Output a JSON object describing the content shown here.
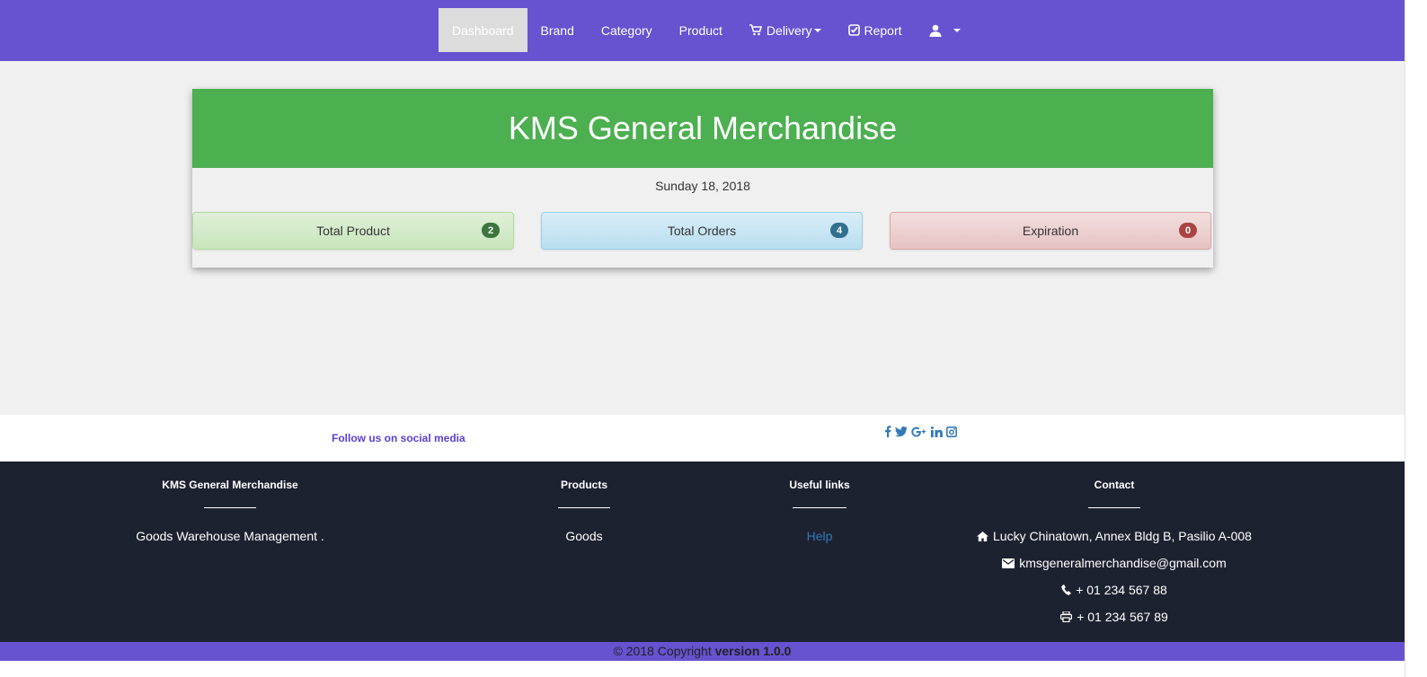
{
  "nav": {
    "items": [
      {
        "label": "Dashboard"
      },
      {
        "label": "Brand"
      },
      {
        "label": "Category"
      },
      {
        "label": "Product"
      },
      {
        "label": "Delivery",
        "icon": "cart-icon"
      },
      {
        "label": "Report",
        "icon": "check-square-icon"
      }
    ],
    "user_icon": "user-icon"
  },
  "header": {
    "title": "KMS General Merchandise",
    "date": "Sunday 18, 2018"
  },
  "stats": [
    {
      "label": "Total Product",
      "count": "2"
    },
    {
      "label": "Total Orders",
      "count": "4"
    },
    {
      "label": "Expiration",
      "count": "0"
    }
  ],
  "social": {
    "follow_text": "Follow us on social media",
    "icons": [
      "facebook-icon",
      "twitter-icon",
      "google-plus-icon",
      "linkedin-icon",
      "instagram-icon"
    ]
  },
  "footer": {
    "company": {
      "heading": "KMS General Merchandise",
      "text": "Goods Warehouse Management ."
    },
    "products": {
      "heading": "Products",
      "item": "Goods"
    },
    "links": {
      "heading": "Useful links",
      "item": "Help"
    },
    "contact": {
      "heading": "Contact",
      "address": "Lucky Chinatown, Annex Bldg B, Pasilio A-008",
      "email": "kmsgeneralmerchandise@gmail.com",
      "phone": "+ 01 234 567 88",
      "fax": "+ 01 234 567 89"
    }
  },
  "copyright": {
    "text": "© 2018 Copyright ",
    "version": "version 1.0.0"
  },
  "colors": {
    "navbar": "#6752d0",
    "header_green": "#4caf50",
    "footer_bg": "#1d2231",
    "link": "#337ab7"
  }
}
